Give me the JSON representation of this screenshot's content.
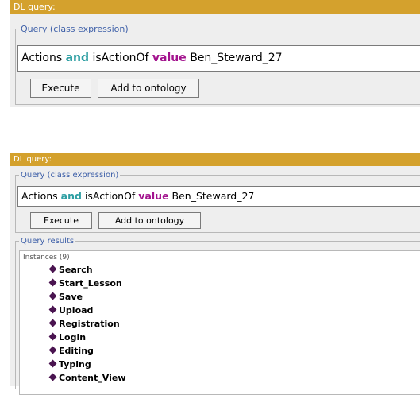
{
  "top": {
    "title": "DL query:",
    "query_legend": "Query (class expression)",
    "query": {
      "w1": "Actions",
      "w2": "and",
      "w3": "isActionOf",
      "w4": "value",
      "w5": "Ben_Steward_27"
    },
    "execute_label": "Execute",
    "add_label": "Add to ontology"
  },
  "bottom": {
    "title": "DL query:",
    "query_legend": "Query (class expression)",
    "query": {
      "w1": "Actions",
      "w2": "and",
      "w3": "isActionOf",
      "w4": "value",
      "w5": "Ben_Steward_27"
    },
    "execute_label": "Execute",
    "add_label": "Add to ontology",
    "results_legend": "Query results",
    "instances_header": "Instances (9)",
    "instances": [
      "Search",
      "Start_Lesson",
      "Save",
      "Upload",
      "Registration",
      "Login",
      "Editing",
      "Typing",
      "Content_View"
    ]
  },
  "colors": {
    "titlebar": "#d4a12d",
    "legend": "#3d5fa8",
    "keyword_and": "#2e9fa3",
    "keyword_value": "#a3138e",
    "instance_icon": "#4a1450"
  },
  "icons": {
    "instance": "individual-diamond-icon"
  }
}
